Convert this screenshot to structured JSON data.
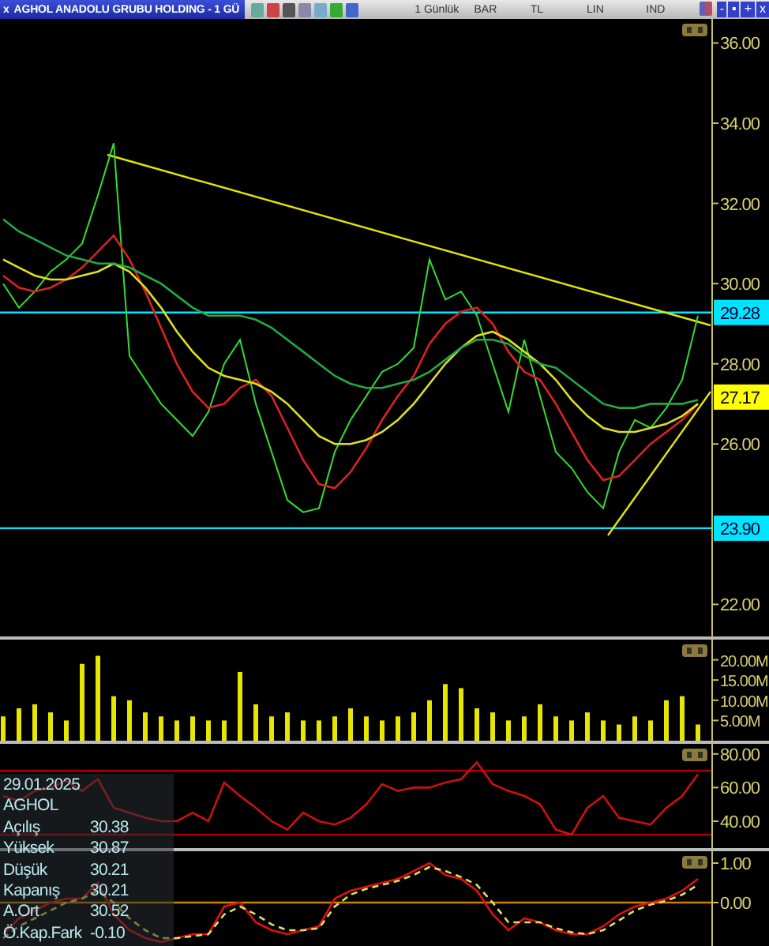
{
  "window": {
    "close": "x",
    "title": "AGHOL ANADOLU GRUBU HOLDING - 1 GÜ",
    "controls": [
      "-",
      "▪",
      "+",
      "x"
    ]
  },
  "toolbar": {
    "period": "1 Günlük",
    "style": "BAR",
    "currency": "TL",
    "scale": "LIN",
    "indicators": "IND"
  },
  "price_pane": {
    "chart_data": {
      "type": "line",
      "ylim": [
        21.2,
        36.6
      ],
      "yticks": [
        {
          "value": 22,
          "label": "22.00"
        },
        {
          "value": 26,
          "label": "26.00"
        },
        {
          "value": 28,
          "label": "28.00"
        },
        {
          "value": 30,
          "label": "30.00"
        },
        {
          "value": 32,
          "label": "32.00"
        },
        {
          "value": 34,
          "label": "34.00"
        },
        {
          "value": 36,
          "label": "36.00"
        }
      ],
      "series": [
        {
          "color": "#33dd33",
          "values": [
            30.0,
            29.4,
            29.8,
            30.3,
            30.6,
            31.0,
            32.2,
            33.5,
            28.2,
            27.6,
            27.0,
            26.6,
            26.2,
            26.8,
            28.0,
            28.6,
            27.0,
            25.8,
            24.6,
            24.3,
            24.4,
            25.8,
            26.6,
            27.2,
            27.8,
            28.0,
            28.4,
            30.6,
            29.6,
            29.8,
            29.2,
            28.0,
            26.8,
            28.6,
            27.2,
            25.8,
            25.4,
            24.8,
            24.4,
            25.8,
            26.6,
            26.4,
            26.9,
            27.6,
            29.2
          ]
        },
        {
          "color": "#dd2222",
          "values": [
            30.2,
            29.9,
            29.8,
            29.9,
            30.1,
            30.4,
            30.8,
            31.2,
            30.6,
            29.8,
            28.9,
            28.0,
            27.3,
            26.9,
            27.0,
            27.4,
            27.6,
            27.2,
            26.4,
            25.6,
            25.0,
            24.9,
            25.3,
            25.9,
            26.6,
            27.2,
            27.7,
            28.5,
            29.0,
            29.3,
            29.4,
            29.0,
            28.3,
            27.8,
            27.6,
            27.0,
            26.3,
            25.6,
            25.1,
            25.2,
            25.6,
            26.0,
            26.3,
            26.6,
            27.0
          ]
        },
        {
          "color": "#e0e020",
          "values": [
            30.6,
            30.4,
            30.2,
            30.1,
            30.1,
            30.2,
            30.3,
            30.5,
            30.3,
            29.9,
            29.4,
            28.8,
            28.3,
            27.9,
            27.7,
            27.6,
            27.5,
            27.3,
            27.0,
            26.6,
            26.2,
            26.0,
            26.0,
            26.1,
            26.3,
            26.6,
            27.0,
            27.5,
            28.0,
            28.4,
            28.7,
            28.8,
            28.6,
            28.3,
            28.0,
            27.6,
            27.1,
            26.7,
            26.4,
            26.3,
            26.3,
            26.4,
            26.5,
            26.7,
            27.0
          ]
        },
        {
          "color": "#22aa44",
          "values": [
            31.6,
            31.3,
            31.1,
            30.9,
            30.7,
            30.6,
            30.5,
            30.5,
            30.4,
            30.2,
            30.0,
            29.7,
            29.4,
            29.2,
            29.2,
            29.2,
            29.1,
            28.9,
            28.6,
            28.3,
            28.0,
            27.7,
            27.5,
            27.4,
            27.4,
            27.5,
            27.6,
            27.8,
            28.1,
            28.4,
            28.6,
            28.6,
            28.5,
            28.2,
            28.0,
            27.9,
            27.6,
            27.3,
            27.0,
            26.9,
            26.9,
            27.0,
            27.0,
            27.0,
            27.1
          ]
        }
      ],
      "annotations": [
        {
          "y": 27.17,
          "text": "27.17"
        }
      ],
      "ref_lines": [
        {
          "axis": "y",
          "value": 29.28,
          "label": "29.28",
          "color": "#00e5ff"
        },
        {
          "axis": "y",
          "value": 23.9,
          "label": "23.90",
          "color": "#00e5ff"
        }
      ]
    }
  },
  "volume_pane": {
    "chart_data": {
      "type": "bar",
      "ylim": [
        0,
        25
      ],
      "yticks": [
        {
          "value": 5,
          "label": "5.00M"
        },
        {
          "value": 10,
          "label": "10.00M"
        },
        {
          "value": 15,
          "label": "15.00M"
        },
        {
          "value": 20,
          "label": "20.00M"
        }
      ],
      "series": [
        {
          "color": "#e6e600",
          "values": [
            6,
            8,
            9,
            7,
            5,
            19,
            21,
            11,
            10,
            7,
            6,
            5,
            6,
            5,
            5,
            17,
            9,
            6,
            7,
            5,
            5,
            6,
            8,
            6,
            5,
            6,
            7,
            10,
            14,
            13,
            8,
            7,
            5,
            6,
            9,
            6,
            5,
            7,
            5,
            4,
            6,
            5,
            10,
            11,
            4
          ]
        }
      ]
    }
  },
  "rsi_pane": {
    "chart_data": {
      "type": "line",
      "ylim": [
        24,
        86
      ],
      "yticks": [
        {
          "value": 40,
          "label": "40.00"
        },
        {
          "value": 60,
          "label": "60.00"
        },
        {
          "value": 80,
          "label": "80.00"
        }
      ],
      "series": [
        {
          "color": "#cc1111",
          "values": [
            55,
            52,
            58,
            60,
            64,
            58,
            65,
            48,
            45,
            42,
            40,
            40,
            45,
            40,
            63,
            55,
            48,
            40,
            35,
            45,
            40,
            38,
            42,
            50,
            62,
            58,
            60,
            60,
            63,
            65,
            75,
            62,
            58,
            55,
            50,
            35,
            32,
            48,
            55,
            42,
            40,
            38,
            48,
            55,
            68
          ]
        }
      ],
      "ref_lines": [
        {
          "axis": "y",
          "value": 70,
          "color": "#aa0000"
        },
        {
          "axis": "y",
          "value": 32,
          "color": "#aa0000"
        }
      ]
    }
  },
  "macd_pane": {
    "chart_data": {
      "type": "line",
      "ylim": [
        -1.1,
        1.3
      ],
      "yticks": [
        {
          "value": 0,
          "label": "0.00"
        },
        {
          "value": 1,
          "label": "1.00"
        }
      ],
      "series": [
        {
          "color": "#dd1111",
          "values": [
            -0.8,
            -0.4,
            -0.2,
            0.0,
            0.1,
            0.1,
            0.5,
            -0.3,
            -0.7,
            -0.9,
            -1.0,
            -0.9,
            -0.8,
            -0.8,
            -0.1,
            0.0,
            -0.5,
            -0.7,
            -0.8,
            -0.7,
            -0.6,
            0.1,
            0.3,
            0.4,
            0.5,
            0.6,
            0.8,
            1.0,
            0.7,
            0.6,
            0.3,
            -0.3,
            -0.7,
            -0.4,
            -0.5,
            -0.7,
            -0.8,
            -0.8,
            -0.6,
            -0.3,
            -0.1,
            0.0,
            0.1,
            0.3,
            0.6
          ]
        },
        {
          "color": "#e0e060",
          "line_style": "dashed",
          "values": [
            -0.9,
            -0.6,
            -0.4,
            -0.2,
            0.0,
            0.1,
            0.3,
            0.0,
            -0.4,
            -0.7,
            -0.9,
            -0.9,
            -0.85,
            -0.8,
            -0.3,
            -0.1,
            -0.3,
            -0.55,
            -0.7,
            -0.7,
            -0.65,
            -0.1,
            0.2,
            0.35,
            0.45,
            0.55,
            0.7,
            0.9,
            0.8,
            0.65,
            0.45,
            0.0,
            -0.5,
            -0.5,
            -0.5,
            -0.65,
            -0.75,
            -0.8,
            -0.7,
            -0.45,
            -0.2,
            -0.05,
            0.05,
            0.2,
            0.45
          ]
        }
      ],
      "ref_lines": [
        {
          "axis": "y",
          "value": 0,
          "color": "#d08000"
        }
      ]
    }
  },
  "info_panel": {
    "date": "29.01.2025",
    "symbol": "AGHOL",
    "rows": [
      {
        "label": "Açılış",
        "value": "30.38"
      },
      {
        "label": "Yüksek",
        "value": "30.87"
      },
      {
        "label": "Düşük",
        "value": "30.21"
      },
      {
        "label": "Kapanış",
        "value": "30.21"
      },
      {
        "label": "A.Ort",
        "value": "30.52"
      },
      {
        "label": "Ö.Kap.Fark",
        "value": "-0.10"
      }
    ]
  }
}
